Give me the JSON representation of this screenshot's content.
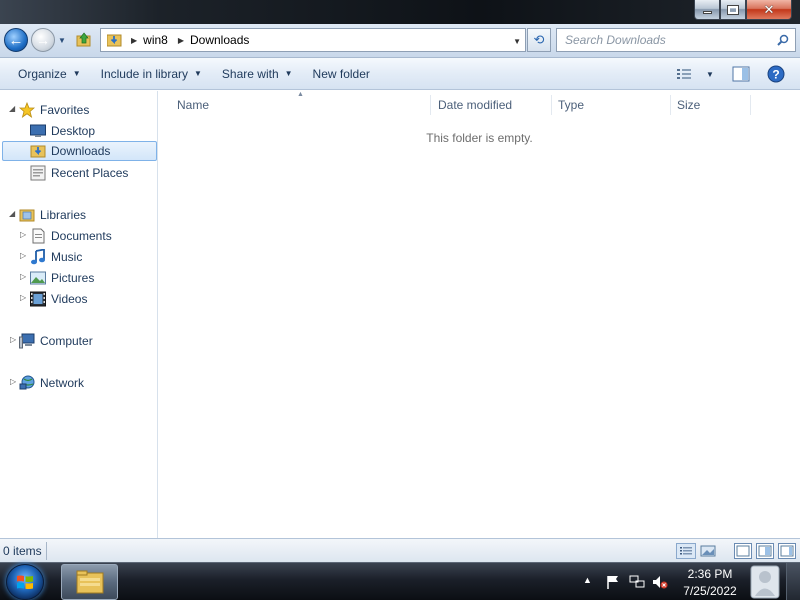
{
  "window": {
    "minimize_icon": "minimize-icon",
    "maximize_icon": "maximize-icon",
    "close_icon": "close-icon"
  },
  "address": {
    "crumbs": [
      "win8",
      "Downloads"
    ],
    "search_placeholder": "Search Downloads"
  },
  "toolbar": {
    "organize": "Organize",
    "include_in_library": "Include in library",
    "share_with": "Share with",
    "new_folder": "New folder"
  },
  "nav": {
    "favorites": "Favorites",
    "desktop": "Desktop",
    "downloads": "Downloads",
    "recent_places": "Recent Places",
    "libraries": "Libraries",
    "documents": "Documents",
    "music": "Music",
    "pictures": "Pictures",
    "videos": "Videos",
    "computer": "Computer",
    "network": "Network"
  },
  "columns": {
    "name": "Name",
    "date_modified": "Date modified",
    "type": "Type",
    "size": "Size"
  },
  "content": {
    "empty_message": "This folder is empty."
  },
  "status": {
    "item_count": "0 items"
  },
  "taskbar": {
    "time": "2:36 PM",
    "date": "7/25/2022"
  },
  "colors": {
    "accent": "#1e395b",
    "selection_border": "#7fb2e8",
    "selection_fill": "#d3e6fa"
  }
}
